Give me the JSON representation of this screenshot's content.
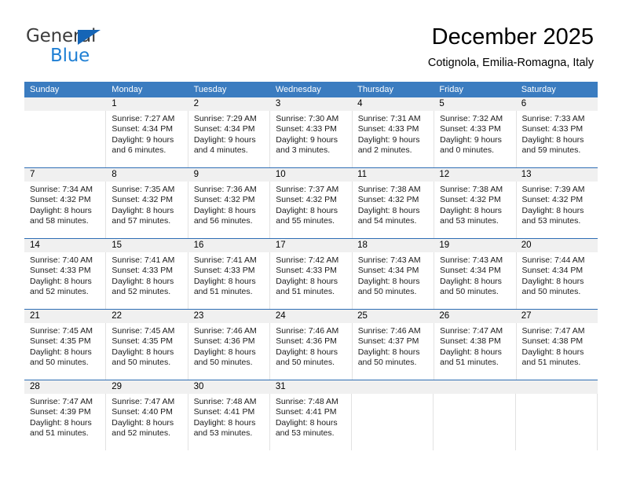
{
  "brand": {
    "name_part1": "General",
    "name_part2": "Blue",
    "accent_color": "#1f7fd4",
    "triangle_color": "#1565b6"
  },
  "header": {
    "title": "December 2025",
    "subtitle": "Cotignola, Emilia-Romagna, Italy"
  },
  "calendar": {
    "header_bg": "#3b7cc0",
    "week_rule_color": "#2e6db4",
    "daynum_bg": "#f0f0f0",
    "weekdays": [
      "Sunday",
      "Monday",
      "Tuesday",
      "Wednesday",
      "Thursday",
      "Friday",
      "Saturday"
    ],
    "weeks": [
      {
        "days": [
          {
            "num": "",
            "sunrise": "",
            "sunset": "",
            "daylight": ""
          },
          {
            "num": "1",
            "sunrise": "Sunrise: 7:27 AM",
            "sunset": "Sunset: 4:34 PM",
            "daylight": "Daylight: 9 hours and 6 minutes."
          },
          {
            "num": "2",
            "sunrise": "Sunrise: 7:29 AM",
            "sunset": "Sunset: 4:34 PM",
            "daylight": "Daylight: 9 hours and 4 minutes."
          },
          {
            "num": "3",
            "sunrise": "Sunrise: 7:30 AM",
            "sunset": "Sunset: 4:33 PM",
            "daylight": "Daylight: 9 hours and 3 minutes."
          },
          {
            "num": "4",
            "sunrise": "Sunrise: 7:31 AM",
            "sunset": "Sunset: 4:33 PM",
            "daylight": "Daylight: 9 hours and 2 minutes."
          },
          {
            "num": "5",
            "sunrise": "Sunrise: 7:32 AM",
            "sunset": "Sunset: 4:33 PM",
            "daylight": "Daylight: 9 hours and 0 minutes."
          },
          {
            "num": "6",
            "sunrise": "Sunrise: 7:33 AM",
            "sunset": "Sunset: 4:33 PM",
            "daylight": "Daylight: 8 hours and 59 minutes."
          }
        ]
      },
      {
        "days": [
          {
            "num": "7",
            "sunrise": "Sunrise: 7:34 AM",
            "sunset": "Sunset: 4:32 PM",
            "daylight": "Daylight: 8 hours and 58 minutes."
          },
          {
            "num": "8",
            "sunrise": "Sunrise: 7:35 AM",
            "sunset": "Sunset: 4:32 PM",
            "daylight": "Daylight: 8 hours and 57 minutes."
          },
          {
            "num": "9",
            "sunrise": "Sunrise: 7:36 AM",
            "sunset": "Sunset: 4:32 PM",
            "daylight": "Daylight: 8 hours and 56 minutes."
          },
          {
            "num": "10",
            "sunrise": "Sunrise: 7:37 AM",
            "sunset": "Sunset: 4:32 PM",
            "daylight": "Daylight: 8 hours and 55 minutes."
          },
          {
            "num": "11",
            "sunrise": "Sunrise: 7:38 AM",
            "sunset": "Sunset: 4:32 PM",
            "daylight": "Daylight: 8 hours and 54 minutes."
          },
          {
            "num": "12",
            "sunrise": "Sunrise: 7:38 AM",
            "sunset": "Sunset: 4:32 PM",
            "daylight": "Daylight: 8 hours and 53 minutes."
          },
          {
            "num": "13",
            "sunrise": "Sunrise: 7:39 AM",
            "sunset": "Sunset: 4:32 PM",
            "daylight": "Daylight: 8 hours and 53 minutes."
          }
        ]
      },
      {
        "days": [
          {
            "num": "14",
            "sunrise": "Sunrise: 7:40 AM",
            "sunset": "Sunset: 4:33 PM",
            "daylight": "Daylight: 8 hours and 52 minutes."
          },
          {
            "num": "15",
            "sunrise": "Sunrise: 7:41 AM",
            "sunset": "Sunset: 4:33 PM",
            "daylight": "Daylight: 8 hours and 52 minutes."
          },
          {
            "num": "16",
            "sunrise": "Sunrise: 7:41 AM",
            "sunset": "Sunset: 4:33 PM",
            "daylight": "Daylight: 8 hours and 51 minutes."
          },
          {
            "num": "17",
            "sunrise": "Sunrise: 7:42 AM",
            "sunset": "Sunset: 4:33 PM",
            "daylight": "Daylight: 8 hours and 51 minutes."
          },
          {
            "num": "18",
            "sunrise": "Sunrise: 7:43 AM",
            "sunset": "Sunset: 4:34 PM",
            "daylight": "Daylight: 8 hours and 50 minutes."
          },
          {
            "num": "19",
            "sunrise": "Sunrise: 7:43 AM",
            "sunset": "Sunset: 4:34 PM",
            "daylight": "Daylight: 8 hours and 50 minutes."
          },
          {
            "num": "20",
            "sunrise": "Sunrise: 7:44 AM",
            "sunset": "Sunset: 4:34 PM",
            "daylight": "Daylight: 8 hours and 50 minutes."
          }
        ]
      },
      {
        "days": [
          {
            "num": "21",
            "sunrise": "Sunrise: 7:45 AM",
            "sunset": "Sunset: 4:35 PM",
            "daylight": "Daylight: 8 hours and 50 minutes."
          },
          {
            "num": "22",
            "sunrise": "Sunrise: 7:45 AM",
            "sunset": "Sunset: 4:35 PM",
            "daylight": "Daylight: 8 hours and 50 minutes."
          },
          {
            "num": "23",
            "sunrise": "Sunrise: 7:46 AM",
            "sunset": "Sunset: 4:36 PM",
            "daylight": "Daylight: 8 hours and 50 minutes."
          },
          {
            "num": "24",
            "sunrise": "Sunrise: 7:46 AM",
            "sunset": "Sunset: 4:36 PM",
            "daylight": "Daylight: 8 hours and 50 minutes."
          },
          {
            "num": "25",
            "sunrise": "Sunrise: 7:46 AM",
            "sunset": "Sunset: 4:37 PM",
            "daylight": "Daylight: 8 hours and 50 minutes."
          },
          {
            "num": "26",
            "sunrise": "Sunrise: 7:47 AM",
            "sunset": "Sunset: 4:38 PM",
            "daylight": "Daylight: 8 hours and 51 minutes."
          },
          {
            "num": "27",
            "sunrise": "Sunrise: 7:47 AM",
            "sunset": "Sunset: 4:38 PM",
            "daylight": "Daylight: 8 hours and 51 minutes."
          }
        ]
      },
      {
        "days": [
          {
            "num": "28",
            "sunrise": "Sunrise: 7:47 AM",
            "sunset": "Sunset: 4:39 PM",
            "daylight": "Daylight: 8 hours and 51 minutes."
          },
          {
            "num": "29",
            "sunrise": "Sunrise: 7:47 AM",
            "sunset": "Sunset: 4:40 PM",
            "daylight": "Daylight: 8 hours and 52 minutes."
          },
          {
            "num": "30",
            "sunrise": "Sunrise: 7:48 AM",
            "sunset": "Sunset: 4:41 PM",
            "daylight": "Daylight: 8 hours and 53 minutes."
          },
          {
            "num": "31",
            "sunrise": "Sunrise: 7:48 AM",
            "sunset": "Sunset: 4:41 PM",
            "daylight": "Daylight: 8 hours and 53 minutes."
          },
          {
            "num": "",
            "sunrise": "",
            "sunset": "",
            "daylight": ""
          },
          {
            "num": "",
            "sunrise": "",
            "sunset": "",
            "daylight": ""
          },
          {
            "num": "",
            "sunrise": "",
            "sunset": "",
            "daylight": ""
          }
        ]
      }
    ]
  }
}
